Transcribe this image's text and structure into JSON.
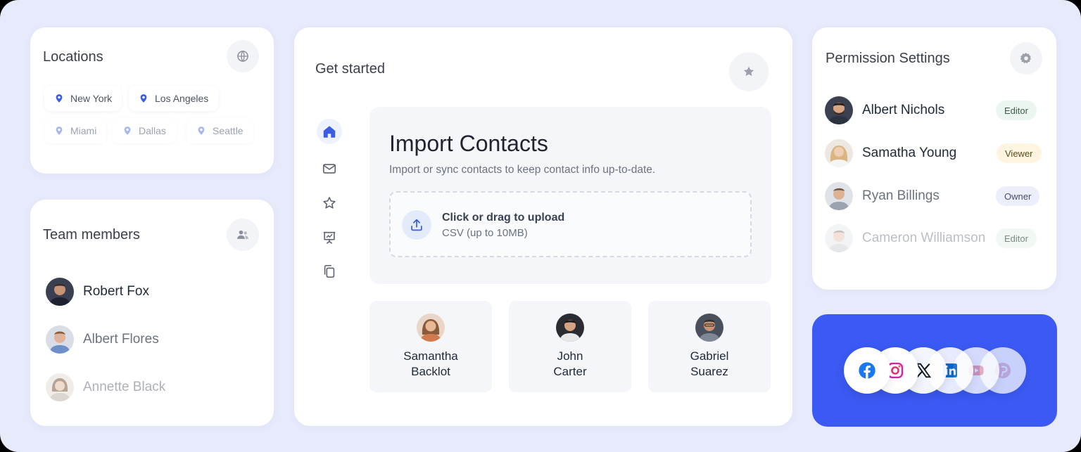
{
  "locations": {
    "title": "Locations",
    "items": [
      {
        "label": "New York"
      },
      {
        "label": "Los Angeles"
      },
      {
        "label": "Miami"
      },
      {
        "label": "Dallas"
      },
      {
        "label": "Seattle"
      }
    ]
  },
  "team": {
    "title": "Team members",
    "members": [
      {
        "name": "Robert Fox"
      },
      {
        "name": "Albert Flores"
      },
      {
        "name": "Annette Black"
      }
    ]
  },
  "get_started": {
    "title": "Get started",
    "nav_icons": [
      "home-icon",
      "mail-icon",
      "star-icon",
      "presentation-icon",
      "copy-icon"
    ],
    "import": {
      "title": "Import Contacts",
      "subtitle": "Import or sync contacts to keep contact info up-to-date.",
      "upload_title": "Click or drag to upload",
      "upload_sub": "CSV (up to 10MB)"
    },
    "contacts": [
      {
        "first": "Samantha",
        "last": "Backlot"
      },
      {
        "first": "John",
        "last": "Carter"
      },
      {
        "first": "Gabriel",
        "last": "Suarez"
      }
    ]
  },
  "permissions": {
    "title": "Permission Settings",
    "users": [
      {
        "name": "Albert Nichols",
        "role": "Editor"
      },
      {
        "name": "Samatha Young",
        "role": "Viewer"
      },
      {
        "name": "Ryan Billings",
        "role": "Owner"
      },
      {
        "name": "Cameron Williamson",
        "role": "Editor"
      }
    ]
  },
  "social": {
    "icons": [
      "facebook-icon",
      "instagram-icon",
      "x-icon",
      "linkedin-icon",
      "youtube-icon",
      "pinterest-icon"
    ]
  },
  "colors": {
    "accent": "#3b5af4",
    "pin": "#3b5ce6",
    "background": "#e7eafb"
  }
}
